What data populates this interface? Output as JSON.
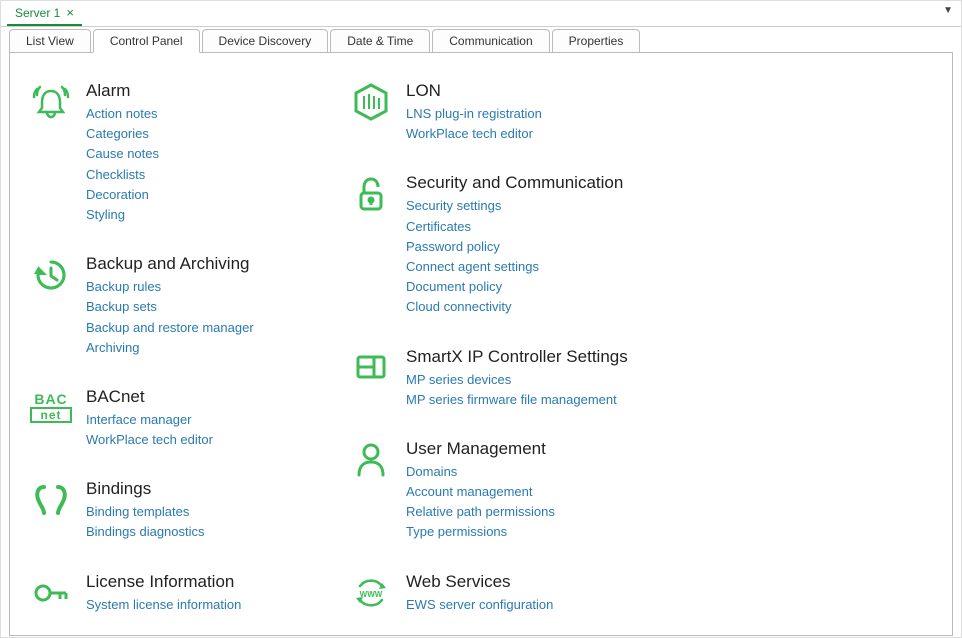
{
  "topTab": {
    "label": "Server 1"
  },
  "subTabs": [
    "List View",
    "Control Panel",
    "Device Discovery",
    "Date & Time",
    "Communication",
    "Properties"
  ],
  "activeSubTab": 1,
  "columns": [
    [
      {
        "title": "Alarm",
        "icon": "alarm",
        "links": [
          "Action notes",
          "Categories",
          "Cause notes",
          "Checklists",
          "Decoration",
          "Styling"
        ]
      },
      {
        "title": "Backup and Archiving",
        "icon": "backup",
        "links": [
          "Backup rules",
          "Backup sets",
          "Backup and restore manager",
          "Archiving"
        ]
      },
      {
        "title": "BACnet",
        "icon": "bacnet",
        "links": [
          "Interface manager",
          "WorkPlace tech editor"
        ]
      },
      {
        "title": "Bindings",
        "icon": "bindings",
        "links": [
          "Binding templates",
          "Bindings diagnostics"
        ]
      },
      {
        "title": "License Information",
        "icon": "key",
        "links": [
          "System license information"
        ]
      }
    ],
    [
      {
        "title": "LON",
        "icon": "lon",
        "links": [
          "LNS plug-in registration",
          "WorkPlace tech editor"
        ]
      },
      {
        "title": "Security and Communication",
        "icon": "lock",
        "links": [
          "Security settings",
          "Certificates",
          "Password policy",
          "Connect agent settings",
          "Document policy",
          "Cloud connectivity"
        ]
      },
      {
        "title": "SmartX IP Controller Settings",
        "icon": "controller",
        "links": [
          "MP series devices",
          "MP series firmware file management"
        ]
      },
      {
        "title": "User Management",
        "icon": "user",
        "links": [
          "Domains",
          "Account management",
          "Relative path permissions",
          "Type permissions"
        ]
      },
      {
        "title": "Web Services",
        "icon": "web",
        "links": [
          "EWS server configuration"
        ]
      }
    ]
  ]
}
